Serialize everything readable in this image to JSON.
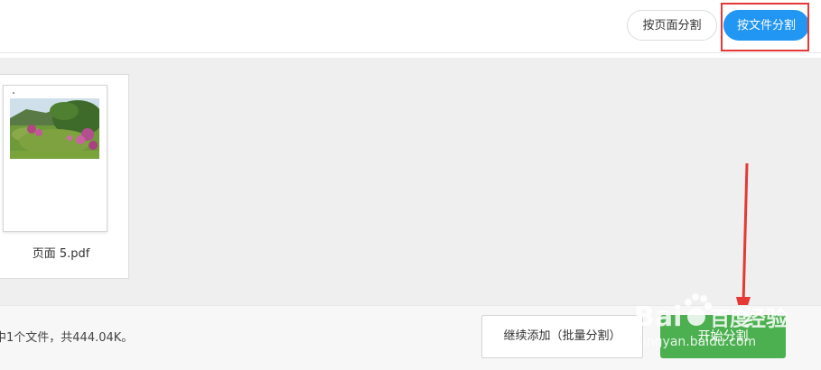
{
  "toolbar": {
    "split_by_page_label": "按页面分割",
    "split_by_file_label": "按文件分割",
    "active_mode": "split_by_file"
  },
  "workspace": {
    "files": [
      {
        "name": "页面 5.pdf",
        "thumbnail": "landscape-photo"
      }
    ]
  },
  "footer": {
    "status": "中1个文件，共444.04K。",
    "add_batch_label": "继续添加（批量分割）",
    "start_label": "开始分割"
  },
  "watermark": {
    "brand": "Bai",
    "brand_suffix": "百度",
    "product": "经验",
    "url": "jingyan.baidu.com"
  },
  "colors": {
    "primary": "#2196f3",
    "start_button": "#4caf50",
    "annotation": "#e53935",
    "workspace_bg": "#efefef"
  },
  "icons": {
    "annotation_arrow": "arrow-down-icon",
    "watermark_paw": "paw-icon"
  }
}
